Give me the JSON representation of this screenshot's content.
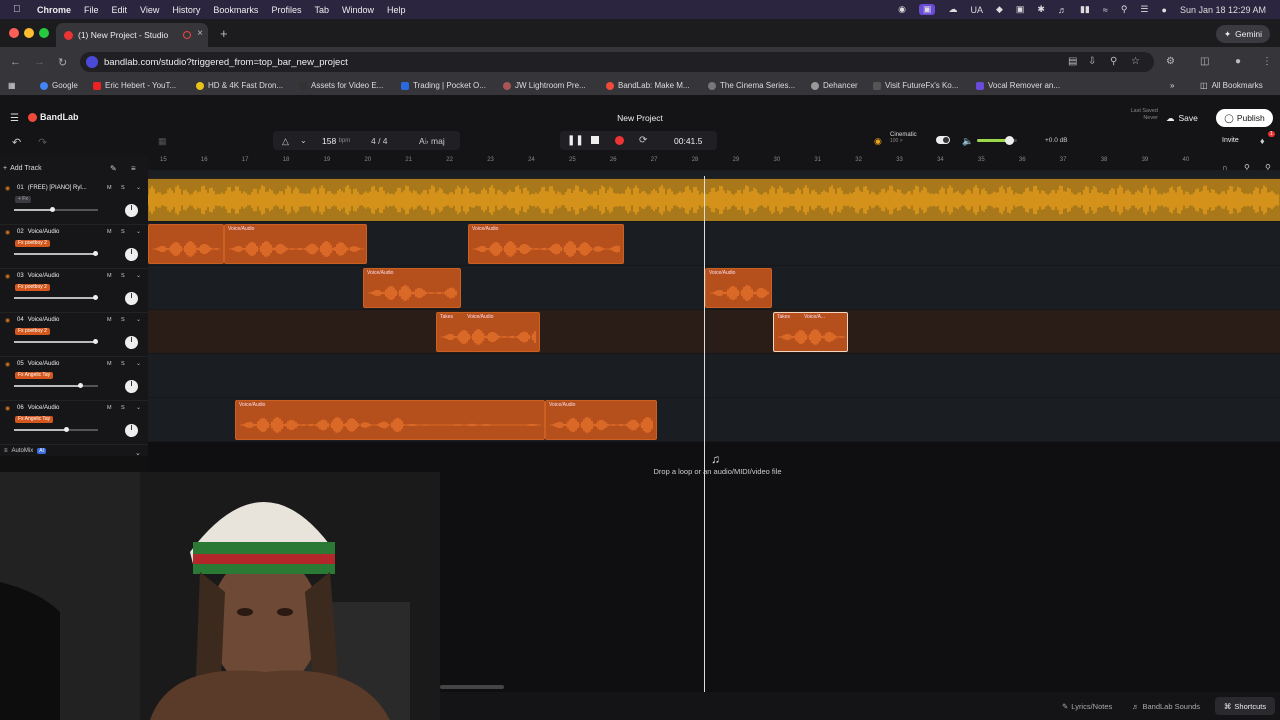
{
  "menubar": {
    "app": "Chrome",
    "items": [
      "File",
      "Edit",
      "View",
      "History",
      "Bookmarks",
      "Profiles",
      "Tab",
      "Window",
      "Help"
    ],
    "lang": "UA",
    "datetime": "Sun Jan 18  12:29 AM"
  },
  "browser": {
    "tab_title": "(1) New Project - Studio",
    "url": "bandlab.com/studio?triggered_from=top_bar_new_project",
    "gemini": "Gemini",
    "bookmarks": [
      "Google",
      "Eric Hebert - YouT...",
      "HD & 4K Fast Dron...",
      "Assets for Video E...",
      "Trading | Pocket O...",
      "JW Lightroom Pre...",
      "BandLab: Make M...",
      "The Cinema Series...",
      "Dehancer",
      "Visit FutureFx's Ko...",
      "Vocal Remover an..."
    ],
    "all_bookmarks": "All Bookmarks"
  },
  "studio": {
    "logo": "BandLab",
    "project_name": "New Project",
    "last_saved_label": "Last Saved",
    "last_saved_value": "Never",
    "save": "Save",
    "publish": "Publish",
    "invite": "Invite",
    "notif_count": "1",
    "tempo": "158",
    "tempo_unit": "bpm",
    "time_sig": "4 / 4",
    "key": "A♭ maj",
    "time": "00:41.5",
    "cinematic_label": "Cinematic",
    "cinematic_sub": "100 >",
    "volume_db": "+0.0 dB",
    "volume_level": 0.8,
    "add_track": "Add Track",
    "automix": "AutoMix",
    "automix_badge": "AI",
    "drop_text": "Drop a loop or an audio/MIDI/video file",
    "ruler": [
      "15",
      "16",
      "17",
      "18",
      "19",
      "20",
      "21",
      "22",
      "23",
      "24",
      "25",
      "26",
      "27",
      "28",
      "29",
      "30",
      "31",
      "32",
      "33",
      "34",
      "35",
      "36",
      "37",
      "38",
      "39",
      "40"
    ]
  },
  "tracks": [
    {
      "num": "01",
      "name": "(FREE) [PIANO] Ryl...",
      "fx": "+ Fx",
      "fx_active": false,
      "volume": 0.45,
      "color": "#f2a41c"
    },
    {
      "num": "02",
      "name": "Voice/Audio",
      "fx": "Fx  poetboy 2",
      "fx_active": true,
      "volume": 0.97,
      "color": "#d8621f"
    },
    {
      "num": "03",
      "name": "Voice/Audio",
      "fx": "Fx  poetboy 2",
      "fx_active": true,
      "volume": 0.97,
      "color": "#d8621f"
    },
    {
      "num": "04",
      "name": "Voice/Audio",
      "fx": "Fx  poetboy 2",
      "fx_active": true,
      "volume": 0.97,
      "color": "#d8621f"
    },
    {
      "num": "05",
      "name": "Voice/Audio",
      "fx": "Fx  Angelic Tay",
      "fx_active": true,
      "volume": 0.79,
      "color": "#d8621f"
    },
    {
      "num": "06",
      "name": "Voice/Audio",
      "fx": "Fx  Angelic Tay",
      "fx_active": true,
      "volume": 0.62,
      "color": "#d8621f"
    }
  ],
  "clip_labels": {
    "voice": "Voice/Audio",
    "takes": "Takes",
    "voice_short": "Voice/A..."
  },
  "bottom": {
    "lyrics": "Lyrics/Notes",
    "sounds": "BandLab Sounds",
    "shortcuts": "Shortcuts"
  }
}
